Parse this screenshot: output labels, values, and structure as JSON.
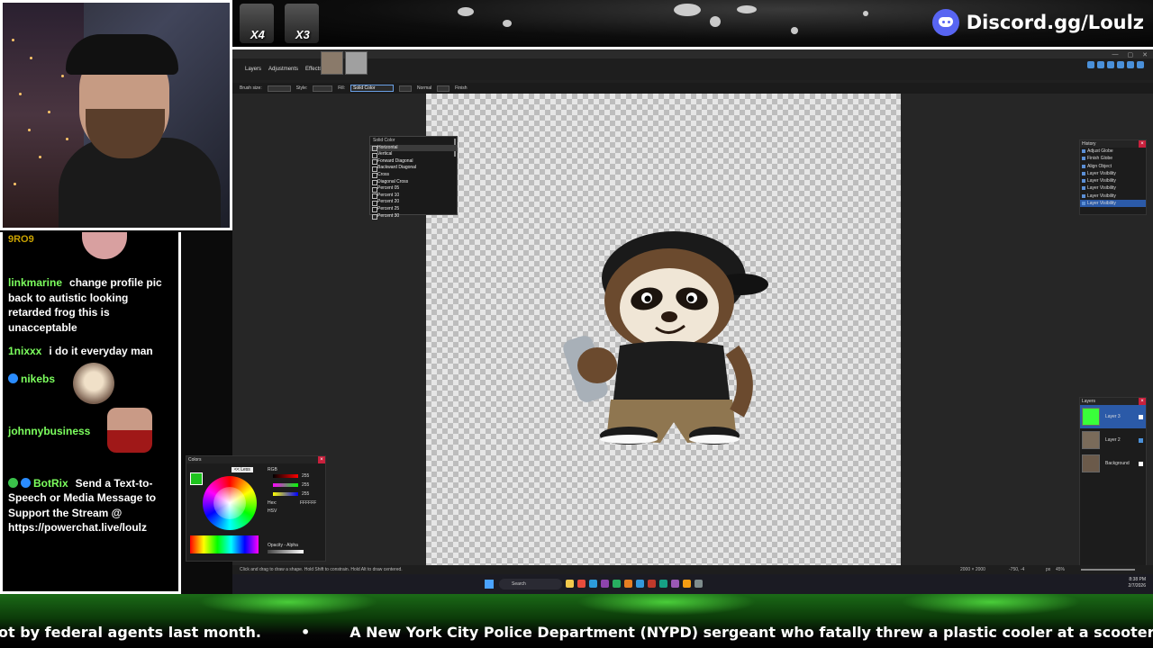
{
  "overlay": {
    "discord": "Discord.gg/Loulz",
    "counters": [
      {
        "label": "X4"
      },
      {
        "label": "X3"
      }
    ]
  },
  "chat": {
    "top_user": "9RO9",
    "messages": [
      {
        "user": "linkmarine",
        "user_color": "#7cff5e",
        "text": "change profile pic back to autistic looking retarded frog this is unacceptable"
      },
      {
        "user": "1nixxx",
        "user_color": "#7cff5e",
        "text": "i do it everyday man"
      },
      {
        "user": "nikebs",
        "user_color": "#7cff5e",
        "text": ""
      },
      {
        "user": "johnnybusiness",
        "user_color": "#7cff5e",
        "text": ""
      },
      {
        "user": "BotRix",
        "user_color": "#7cff5e",
        "text": "Send a Text-to-Speech or Media Message to Support the Stream @ https://powerchat.live/loulz"
      }
    ]
  },
  "app": {
    "menu": [
      "Layers",
      "Adjustments",
      "Effects"
    ],
    "toolbar": {
      "brush_size": "Brush size:",
      "style": "Style:",
      "fill_label": "Fill:",
      "fill_value": "Solid Color",
      "blend": "Normal",
      "finish": "Finish"
    },
    "fill_options": [
      "Solid Color",
      "Horizontal",
      "Vertical",
      "Forward Diagonal",
      "Backward Diagonal",
      "Cross",
      "Diagonal Cross",
      "Percent 05",
      "Percent 10",
      "Percent 20",
      "Percent 25",
      "Percent 30"
    ],
    "history": {
      "title": "History",
      "items": [
        "Adjust Globe",
        "Finish Globe",
        "Align Object",
        "Layer Visibility",
        "Layer Visibility",
        "Layer Visibility",
        "Layer Visibility",
        "Layer Visibility"
      ]
    },
    "layers": {
      "title": "Layers",
      "items": [
        {
          "name": "Layer 3",
          "thumb": "#39ff3a"
        },
        {
          "name": "Layer 2",
          "thumb": "#7a6b5a"
        },
        {
          "name": "Background",
          "thumb": "#6b5a4a"
        }
      ]
    },
    "colors": {
      "title": "Colors",
      "rgb": "RGB",
      "hsv": "HSV",
      "hex_label": "Hex:",
      "hex": "FFFFFF",
      "opacity": "Opacity - Alpha",
      "less": "<< Less",
      "r": "255",
      "g": "255",
      "b": "255"
    },
    "status": "Click and drag to draw a shape. Hold Shift to constrain. Hold Alt to draw centered.",
    "image_size": "2000 × 2000",
    "cursor_pos": "-750, -4",
    "zoom": "45%",
    "units": "px",
    "search": "Search",
    "clock_time": "8:38 PM",
    "clock_date": "2/7/2026"
  },
  "ticker": {
    "left": "ot by federal agents last month.",
    "right": "A New York City Police Department (NYPD) sergeant who fatally threw a plastic cooler at a scooter-riding suspec"
  }
}
